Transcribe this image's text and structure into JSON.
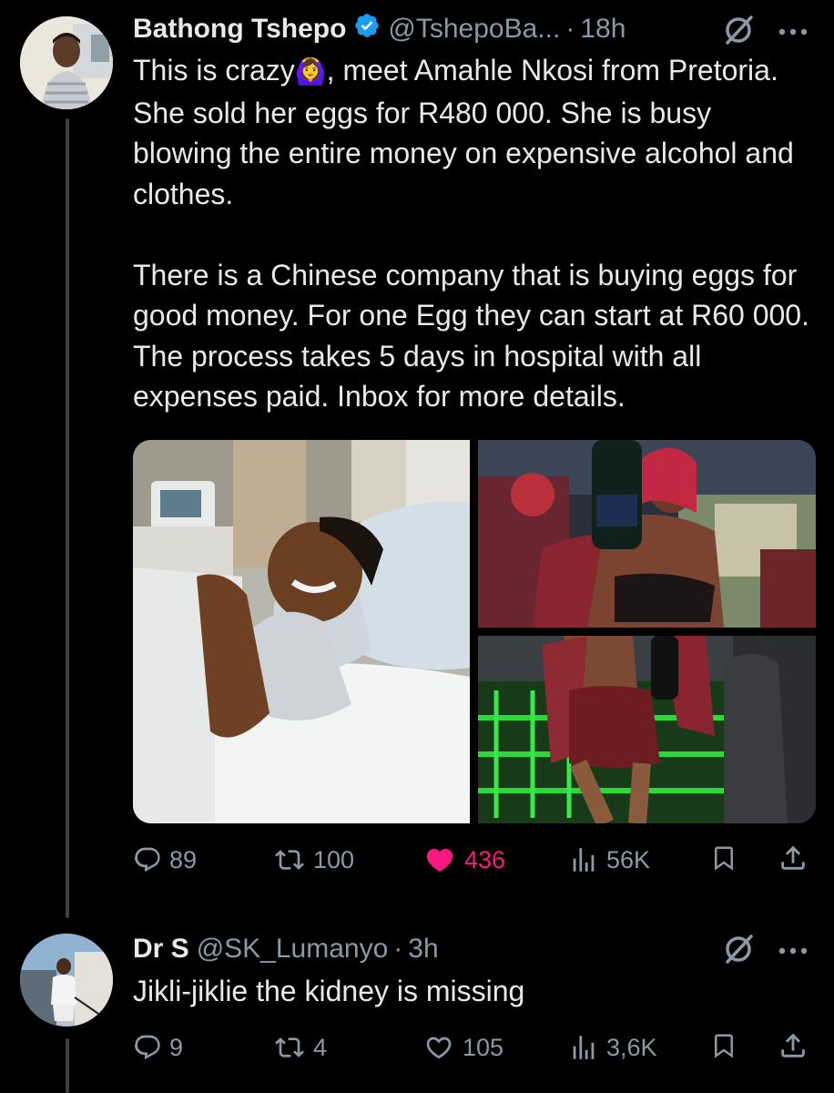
{
  "tweet1": {
    "name": "Bathong Tshepo",
    "handle": "@TshepoBa...",
    "separator": "·",
    "time": "18h",
    "text_p1_a": "This is crazy",
    "text_p1_emoji": "🙆‍♀️",
    "text_p1_b": ", meet Amahle Nkosi from Pretoria. She sold her eggs for R480 000. She is busy blowing the entire money on expensive alcohol and clothes.",
    "text_p2": "There is a Chinese company that is buying eggs for good money. For one Egg they can start at R60 000. The process takes 5 days in hospital with all expenses paid. Inbox for more details.",
    "replies": "89",
    "reposts": "100",
    "likes": "436",
    "views": "56K",
    "liked": true
  },
  "tweet2": {
    "name": "Dr S",
    "handle": "@SK_Lumanyo",
    "separator": "·",
    "time": "3h",
    "text": "Jikli-jiklie the kidney is missing",
    "replies": "9",
    "reposts": "4",
    "likes": "105",
    "views": "3,6K",
    "liked": false
  },
  "icons": {
    "verified": "verified-badge-icon",
    "grok": "grok-icon",
    "more": "more-icon",
    "reply": "reply-icon",
    "repost": "repost-icon",
    "like": "heart-icon",
    "views": "views-icon",
    "bookmark": "bookmark-icon",
    "share": "share-icon"
  },
  "colors": {
    "background": "#000000",
    "text": "#e7e9ea",
    "muted": "#8b98a5",
    "like": "#f91880",
    "verified": "#1d9bf0",
    "thread_line": "#3b3f44"
  }
}
